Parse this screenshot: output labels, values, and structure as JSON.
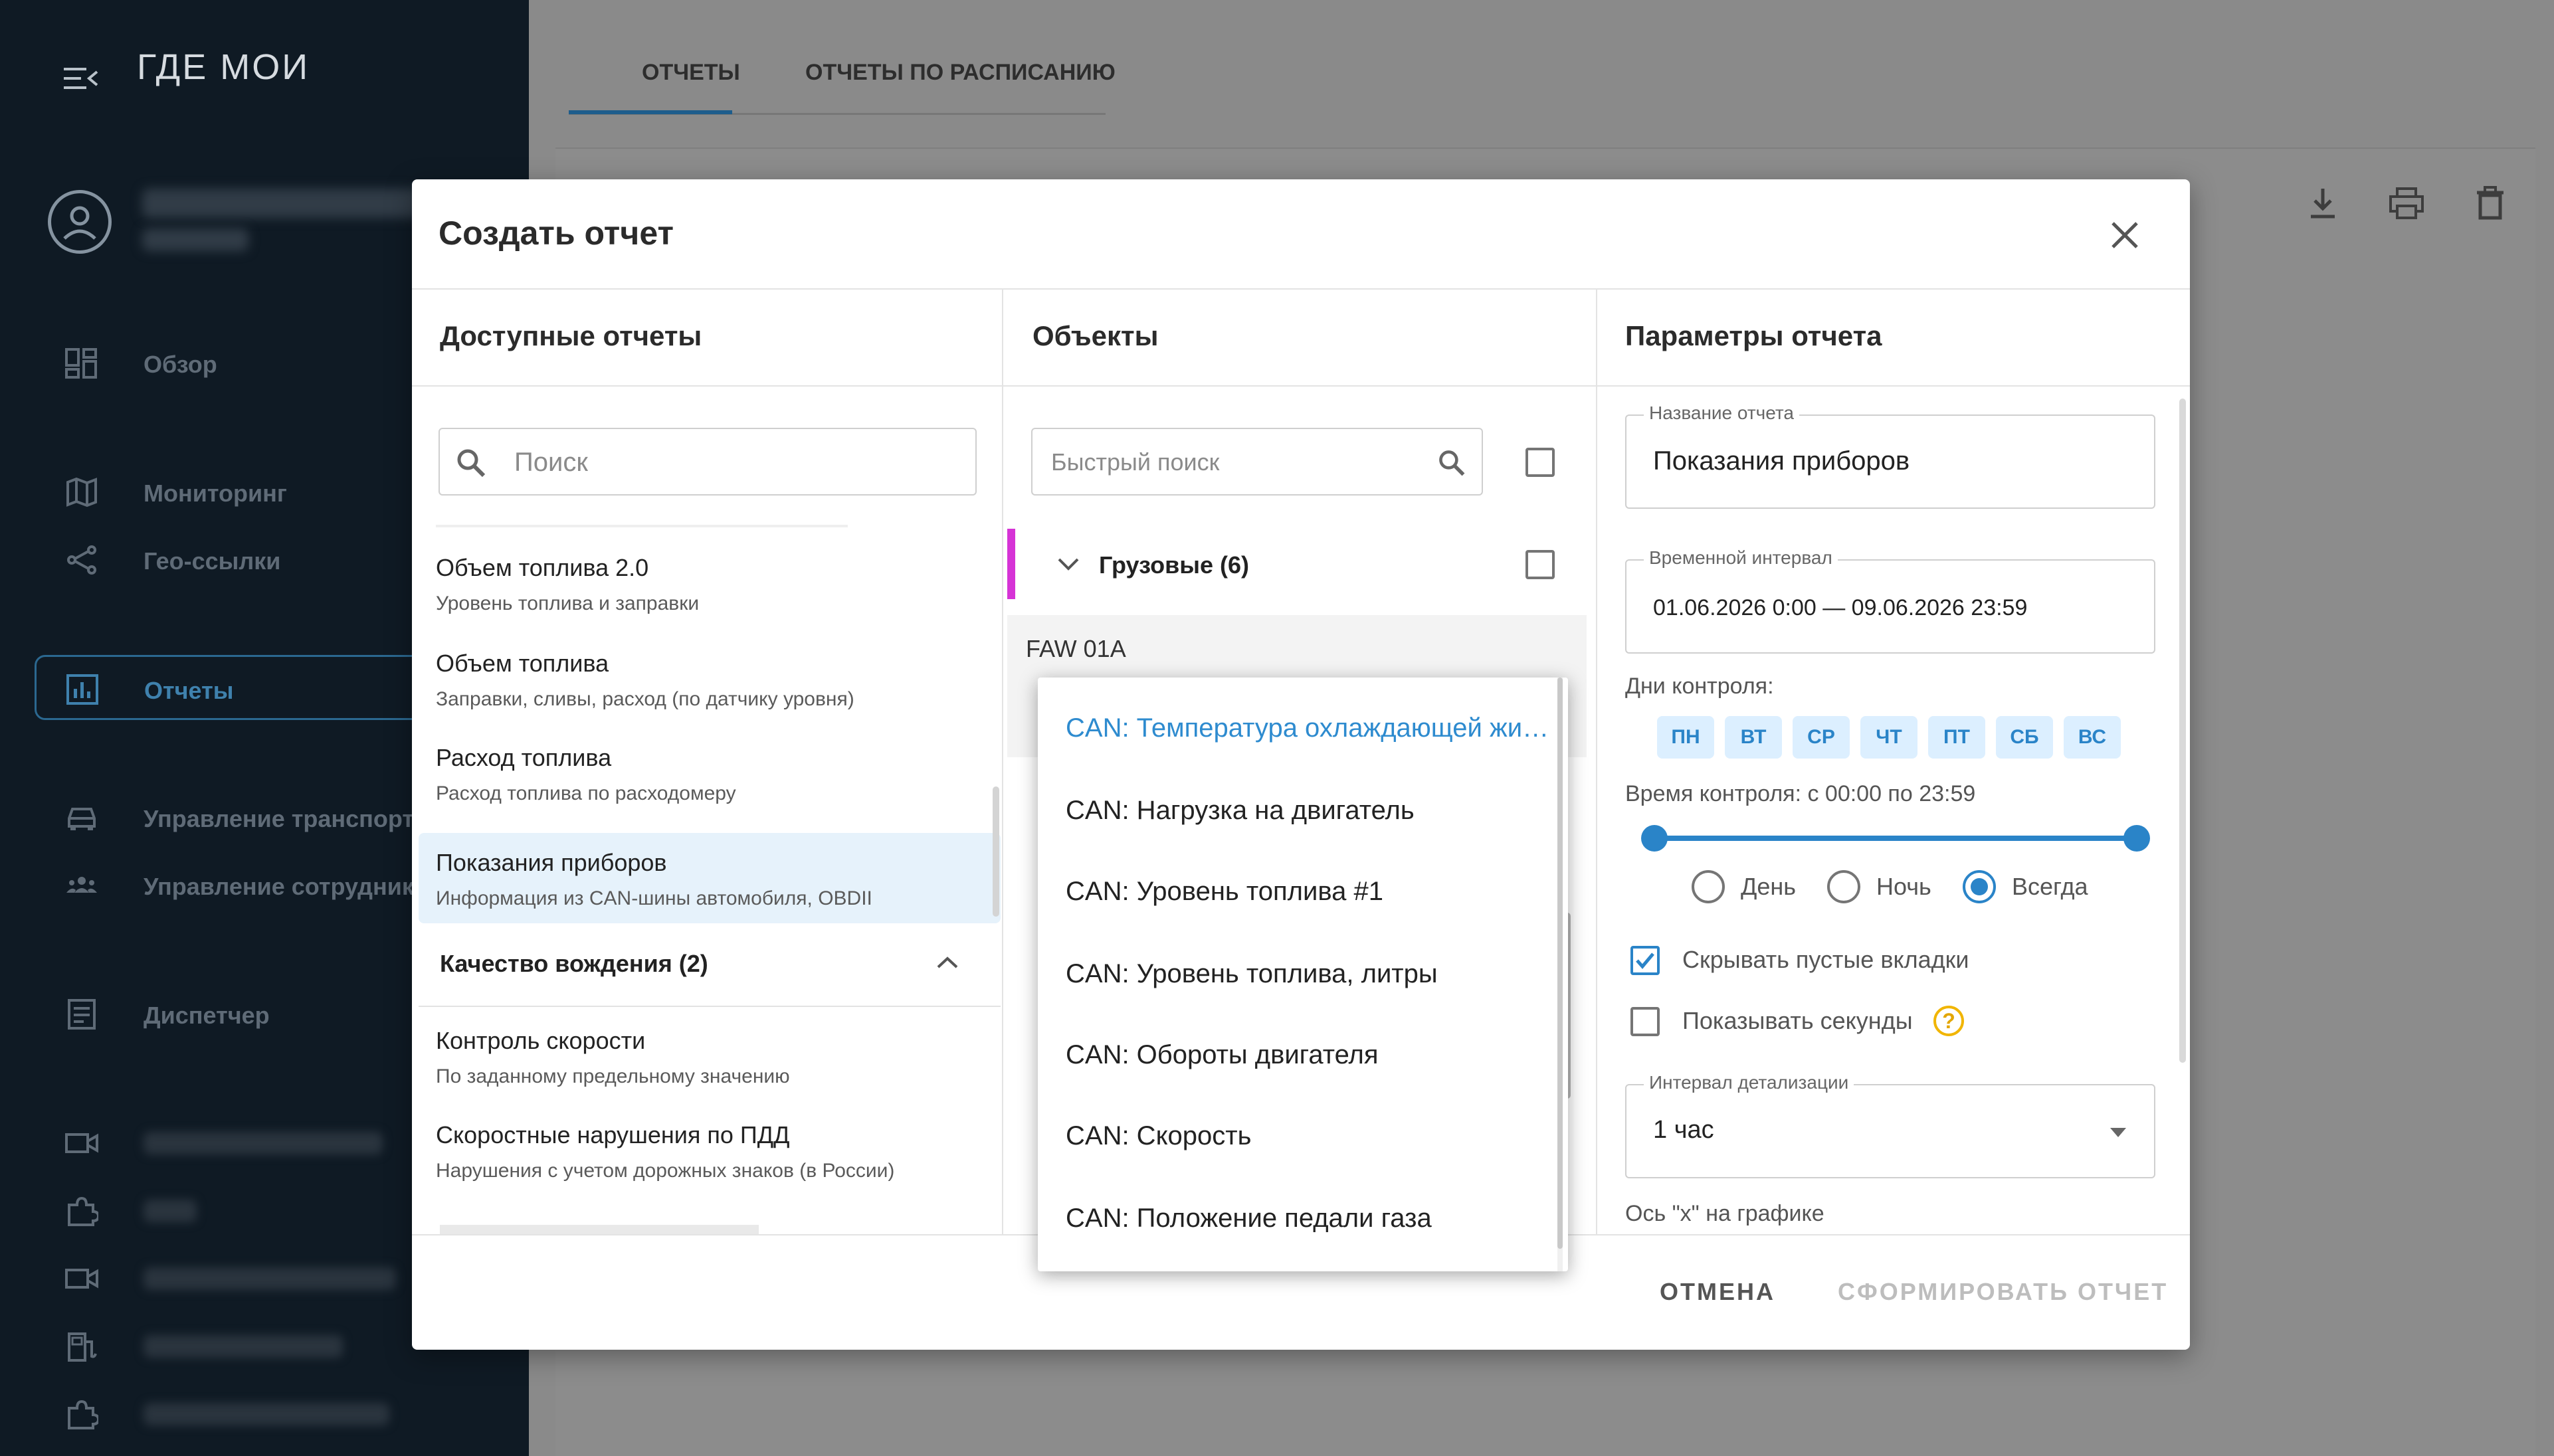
{
  "sidebar": {
    "logo": "ГДЕ МОИ",
    "items": [
      {
        "label": "Обзор",
        "icon": "dashboard-icon"
      },
      {
        "label": "Мониторинг",
        "icon": "map-icon"
      },
      {
        "label": "Гео-ссылки",
        "icon": "share-icon"
      },
      {
        "label": "Отчеты",
        "icon": "chart-icon",
        "active": true
      },
      {
        "label": "Управление транспорто",
        "icon": "car-icon"
      },
      {
        "label": "Управление сотрудника",
        "icon": "people-icon"
      },
      {
        "label": "Диспетчер",
        "icon": "dispatcher-icon"
      }
    ]
  },
  "main": {
    "tabs": [
      {
        "label": "ОТЧЕТЫ",
        "active": true
      },
      {
        "label": "ОТЧЕТЫ ПО РАСПИСАНИЮ"
      }
    ]
  },
  "modal": {
    "title": "Создать отчет",
    "columns": {
      "reports": "Доступные отчеты",
      "objects": "Объекты",
      "params": "Параметры отчета"
    },
    "report_search_placeholder": "Поиск",
    "reports": [
      {
        "title": "Объем топлива 2.0",
        "subtitle": "Уровень топлива и заправки"
      },
      {
        "title": "Объем топлива",
        "subtitle": "Заправки, сливы, расход (по датчику уровня)"
      },
      {
        "title": "Расход топлива",
        "subtitle": "Расход топлива по расходомеру"
      },
      {
        "title": "Показания приборов",
        "subtitle": "Информация из CAN-шины автомобиля, OBDII",
        "selected": true
      }
    ],
    "group_driving": "Качество вождения (2)",
    "driving_reports": [
      {
        "title": "Контроль скорости",
        "subtitle": "По заданному предельному значению"
      },
      {
        "title": "Скоростные нарушения по ПДД",
        "subtitle": "Нарушения с учетом дорожных знаков (в России)"
      }
    ],
    "objects_search_placeholder": "Быстрый поиск",
    "object_group": "Грузовые (6)",
    "object_name": "FAW 01A",
    "dropdown_items": [
      "CAN: Температура охлаждающей жидкости",
      "CAN: Нагрузка на двигатель",
      "CAN: Уровень топлива #1",
      "CAN: Уровень топлива, литры",
      "CAN: Обороты двигателя",
      "CAN: Скорость",
      "CAN: Положение педали газа"
    ],
    "params": {
      "name_label": "Название отчета",
      "name_value": "Показания приборов",
      "interval_label": "Временной интервал",
      "interval_value": "01.06.2026 0:00 — 09.06.2026 23:59",
      "days_label": "Дни контроля:",
      "days": [
        "ПН",
        "ВТ",
        "СР",
        "ЧТ",
        "ПТ",
        "СБ",
        "ВС"
      ],
      "time_label": "Время контроля: с 00:00 по 23:59",
      "radio_options": [
        "День",
        "Ночь",
        "Всегда"
      ],
      "radio_selected": "Всегда",
      "hide_empty_label": "Скрывать пустые вкладки",
      "hide_empty_checked": true,
      "show_seconds_label": "Показывать секунды",
      "show_seconds_checked": false,
      "help_glyph": "?",
      "detail_label": "Интервал детализации",
      "detail_value": "1 час",
      "axis_label": "Ось \"x\" на графике"
    },
    "buttons": {
      "cancel": "ОТМЕНА",
      "submit": "СФОРМИРОВАТЬ ОТЧЕТ"
    }
  },
  "colors": {
    "accent": "#2a84c8",
    "sidebar_bg": "#0f1a24",
    "group_marker": "#d633d6",
    "help": "#f1b500"
  }
}
